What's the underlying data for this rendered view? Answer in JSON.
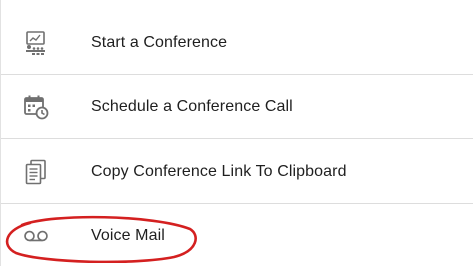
{
  "menu": {
    "items": [
      {
        "label": "Start a Conference",
        "icon": "presentation-icon"
      },
      {
        "label": "Schedule a Conference Call",
        "icon": "calendar-clock-icon"
      },
      {
        "label": "Copy Conference Link To Clipboard",
        "icon": "copy-document-icon"
      },
      {
        "label": "Voice Mail",
        "icon": "voicemail-icon"
      }
    ]
  },
  "colors": {
    "icon": "#707070",
    "text": "#1f1f1f",
    "divider": "#dddddd",
    "highlight": "#d42020"
  }
}
